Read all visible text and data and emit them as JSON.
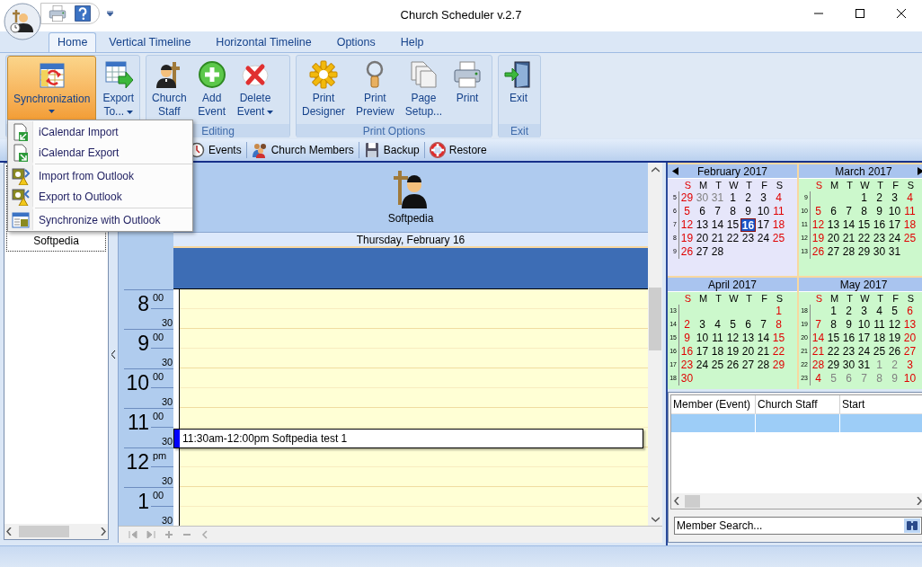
{
  "window": {
    "title": "Church Scheduler v.2.7"
  },
  "tabs": [
    {
      "label": "Home",
      "selected": true
    },
    {
      "label": "Vertical Timeline",
      "selected": false
    },
    {
      "label": "Horizontal Timeline",
      "selected": false
    },
    {
      "label": "Options",
      "selected": false
    },
    {
      "label": "Help",
      "selected": false
    }
  ],
  "ribbon": {
    "groups": [
      {
        "buttons": [
          {
            "lines": [
              "Synchronization"
            ],
            "dropdown": true,
            "selected": true
          },
          {
            "lines": [
              "Export",
              "To..."
            ],
            "dropdown": true,
            "selected": false
          }
        ]
      },
      {
        "label": "Editing",
        "buttons": [
          {
            "lines": [
              "Church",
              "Staff"
            ],
            "dropdown": false,
            "selected": false
          },
          {
            "lines": [
              "Add",
              "Event"
            ],
            "dropdown": false,
            "selected": false
          },
          {
            "lines": [
              "Delete",
              "Event"
            ],
            "dropdown": true,
            "selected": false
          }
        ]
      },
      {
        "label": "Print Options",
        "buttons": [
          {
            "lines": [
              "Print",
              "Designer"
            ],
            "dropdown": false,
            "selected": false
          },
          {
            "lines": [
              "Print",
              "Preview"
            ],
            "dropdown": false,
            "selected": false
          },
          {
            "lines": [
              "Page",
              "Setup..."
            ],
            "dropdown": false,
            "selected": false
          },
          {
            "lines": [
              "Print"
            ],
            "dropdown": false,
            "selected": false
          }
        ]
      },
      {
        "label": "Exit",
        "buttons": [
          {
            "lines": [
              "Exit"
            ],
            "dropdown": false,
            "selected": false
          }
        ]
      }
    ]
  },
  "menu": {
    "items": [
      {
        "label": "iCalendar Import",
        "separator_before": false
      },
      {
        "label": "iCalendar Export",
        "separator_before": false
      },
      {
        "label": "Import from Outlook",
        "separator_before": true
      },
      {
        "label": "Export to Outlook",
        "separator_before": false
      },
      {
        "label": "Synchronize with Outlook",
        "separator_before": true
      }
    ]
  },
  "toolbar": {
    "items": [
      {
        "label": "Events"
      },
      {
        "label": "Church Members"
      },
      {
        "label": "Backup"
      },
      {
        "label": "Restore"
      }
    ]
  },
  "left_panel": {
    "items": [
      {
        "label": "Softpedia"
      }
    ]
  },
  "day_view": {
    "resource": "Softpedia",
    "date": "Thursday, February 16",
    "hours": [
      {
        "hour": "8",
        "first": "00",
        "second": "30"
      },
      {
        "hour": "9",
        "first": "00",
        "second": "30"
      },
      {
        "hour": "10",
        "first": "00",
        "second": "30"
      },
      {
        "hour": "11",
        "first": "00",
        "second": "30"
      },
      {
        "hour": "12",
        "first": "pm",
        "second": "30"
      },
      {
        "hour": "1",
        "first": "00",
        "second": "30"
      }
    ],
    "appointments": [
      {
        "text": "11:30am-12:00pm Softpedia test 1"
      }
    ]
  },
  "calendars": [
    {
      "title": "February 2017",
      "color": "#e6e6fa",
      "weekdays": [
        "S",
        "M",
        "T",
        "W",
        "T",
        "F",
        "S"
      ],
      "weeks": [
        {
          "week": "5",
          "days": [
            {
              "text": "29",
              "selected": false
            },
            {
              "text": "30",
              "selected": false,
              "muted": true
            },
            {
              "text": "31",
              "selected": false,
              "muted": true
            },
            {
              "text": "1",
              "selected": false
            },
            {
              "text": "2",
              "selected": false
            },
            {
              "text": "3",
              "selected": false
            },
            {
              "text": "4",
              "selected": false
            }
          ]
        },
        {
          "week": "6",
          "days": [
            {
              "text": "5",
              "selected": false
            },
            {
              "text": "6",
              "selected": false
            },
            {
              "text": "7",
              "selected": false
            },
            {
              "text": "8",
              "selected": false
            },
            {
              "text": "9",
              "selected": false
            },
            {
              "text": "10",
              "selected": false
            },
            {
              "text": "11",
              "selected": false
            }
          ]
        },
        {
          "week": "7",
          "days": [
            {
              "text": "12",
              "selected": false
            },
            {
              "text": "13",
              "selected": false
            },
            {
              "text": "14",
              "selected": false
            },
            {
              "text": "15",
              "selected": false
            },
            {
              "text": "16",
              "selected": true
            },
            {
              "text": "17",
              "selected": false
            },
            {
              "text": "18",
              "selected": false
            }
          ]
        },
        {
          "week": "8",
          "days": [
            {
              "text": "19",
              "selected": false
            },
            {
              "text": "20",
              "selected": false
            },
            {
              "text": "21",
              "selected": false
            },
            {
              "text": "22",
              "selected": false
            },
            {
              "text": "23",
              "selected": false
            },
            {
              "text": "24",
              "selected": false
            },
            {
              "text": "25",
              "selected": false
            }
          ]
        },
        {
          "week": "9",
          "days": [
            {
              "text": "26",
              "selected": false
            },
            {
              "text": "27",
              "selected": false
            },
            {
              "text": "28",
              "selected": false
            }
          ]
        }
      ]
    },
    {
      "title": "March 2017",
      "color": "#ccf8cc",
      "weekdays": [
        "S",
        "M",
        "T",
        "W",
        "T",
        "F",
        "S"
      ],
      "weeks": [
        {
          "week": "9",
          "days": [
            {
              "text": "1",
              "selected": false
            },
            {
              "text": "2",
              "selected": false
            },
            {
              "text": "3",
              "selected": false
            },
            {
              "text": "4",
              "selected": false
            }
          ]
        },
        {
          "week": "10",
          "days": [
            {
              "text": "5",
              "selected": false
            },
            {
              "text": "6",
              "selected": false
            },
            {
              "text": "7",
              "selected": false
            },
            {
              "text": "8",
              "selected": false
            },
            {
              "text": "9",
              "selected": false
            },
            {
              "text": "10",
              "selected": false
            },
            {
              "text": "11",
              "selected": false
            }
          ]
        },
        {
          "week": "11",
          "days": [
            {
              "text": "12",
              "selected": false
            },
            {
              "text": "13",
              "selected": false
            },
            {
              "text": "14",
              "selected": false
            },
            {
              "text": "15",
              "selected": false
            },
            {
              "text": "16",
              "selected": false
            },
            {
              "text": "17",
              "selected": false
            },
            {
              "text": "18",
              "selected": false
            }
          ]
        },
        {
          "week": "12",
          "days": [
            {
              "text": "19",
              "selected": false
            },
            {
              "text": "20",
              "selected": false
            },
            {
              "text": "21",
              "selected": false
            },
            {
              "text": "22",
              "selected": false
            },
            {
              "text": "23",
              "selected": false
            },
            {
              "text": "24",
              "selected": false
            },
            {
              "text": "25",
              "selected": false
            }
          ]
        },
        {
          "week": "13",
          "days": [
            {
              "text": "26",
              "selected": false
            },
            {
              "text": "27",
              "selected": false
            },
            {
              "text": "28",
              "selected": false
            },
            {
              "text": "29",
              "selected": false
            },
            {
              "text": "30",
              "selected": false
            },
            {
              "text": "31",
              "selected": false
            }
          ]
        }
      ]
    },
    {
      "title": "April 2017",
      "color": "#ccf8cc",
      "weekdays": [
        "S",
        "M",
        "T",
        "W",
        "T",
        "F",
        "S"
      ],
      "weeks": [
        {
          "week": "13",
          "days": [
            {
              "text": "1",
              "selected": false
            }
          ]
        },
        {
          "week": "14",
          "days": [
            {
              "text": "2",
              "selected": false
            },
            {
              "text": "3",
              "selected": false
            },
            {
              "text": "4",
              "selected": false
            },
            {
              "text": "5",
              "selected": false
            },
            {
              "text": "6",
              "selected": false
            },
            {
              "text": "7",
              "selected": false
            },
            {
              "text": "8",
              "selected": false
            }
          ]
        },
        {
          "week": "15",
          "days": [
            {
              "text": "9",
              "selected": false
            },
            {
              "text": "10",
              "selected": false
            },
            {
              "text": "11",
              "selected": false
            },
            {
              "text": "12",
              "selected": false
            },
            {
              "text": "13",
              "selected": false
            },
            {
              "text": "14",
              "selected": false
            },
            {
              "text": "15",
              "selected": false
            }
          ]
        },
        {
          "week": "16",
          "days": [
            {
              "text": "16",
              "selected": false
            },
            {
              "text": "17",
              "selected": false
            },
            {
              "text": "18",
              "selected": false
            },
            {
              "text": "19",
              "selected": false
            },
            {
              "text": "20",
              "selected": false
            },
            {
              "text": "21",
              "selected": false
            },
            {
              "text": "22",
              "selected": false
            }
          ]
        },
        {
          "week": "17",
          "days": [
            {
              "text": "23",
              "selected": false
            },
            {
              "text": "24",
              "selected": false
            },
            {
              "text": "25",
              "selected": false
            },
            {
              "text": "26",
              "selected": false
            },
            {
              "text": "27",
              "selected": false
            },
            {
              "text": "28",
              "selected": false
            },
            {
              "text": "29",
              "selected": false
            }
          ]
        },
        {
          "week": "18",
          "days": [
            {
              "text": "30",
              "selected": false
            }
          ]
        }
      ]
    },
    {
      "title": "May 2017",
      "color": "#ccf8cc",
      "weekdays": [
        "S",
        "M",
        "T",
        "W",
        "T",
        "F",
        "S"
      ],
      "weeks": [
        {
          "week": "18",
          "days": [
            {
              "text": "1",
              "selected": false
            },
            {
              "text": "2",
              "selected": false
            },
            {
              "text": "3",
              "selected": false
            },
            {
              "text": "4",
              "selected": false
            },
            {
              "text": "5",
              "selected": false
            },
            {
              "text": "6",
              "selected": false
            }
          ]
        },
        {
          "week": "19",
          "days": [
            {
              "text": "7",
              "selected": false
            },
            {
              "text": "8",
              "selected": false
            },
            {
              "text": "9",
              "selected": false
            },
            {
              "text": "10",
              "selected": false
            },
            {
              "text": "11",
              "selected": false
            },
            {
              "text": "12",
              "selected": false
            },
            {
              "text": "13",
              "selected": false
            }
          ]
        },
        {
          "week": "20",
          "days": [
            {
              "text": "14",
              "selected": false
            },
            {
              "text": "15",
              "selected": false
            },
            {
              "text": "16",
              "selected": false
            },
            {
              "text": "17",
              "selected": false
            },
            {
              "text": "18",
              "selected": false
            },
            {
              "text": "19",
              "selected": false
            },
            {
              "text": "20",
              "selected": false
            }
          ]
        },
        {
          "week": "21",
          "days": [
            {
              "text": "21",
              "selected": false
            },
            {
              "text": "22",
              "selected": false
            },
            {
              "text": "23",
              "selected": false
            },
            {
              "text": "24",
              "selected": false
            },
            {
              "text": "25",
              "selected": false
            },
            {
              "text": "26",
              "selected": false
            },
            {
              "text": "27",
              "selected": false
            }
          ]
        },
        {
          "week": "22",
          "days": [
            {
              "text": "28",
              "selected": false
            },
            {
              "text": "29",
              "selected": false
            },
            {
              "text": "30",
              "selected": false
            },
            {
              "text": "31",
              "selected": false
            },
            {
              "text": "1",
              "selected": false,
              "muted": true
            },
            {
              "text": "2",
              "selected": false,
              "muted": true
            },
            {
              "text": "3",
              "selected": false
            }
          ]
        },
        {
          "week": "23",
          "days": [
            {
              "text": "4",
              "selected": false
            },
            {
              "text": "5",
              "selected": false,
              "muted": true
            },
            {
              "text": "6",
              "selected": false,
              "muted": true
            },
            {
              "text": "7",
              "selected": false,
              "muted": true
            },
            {
              "text": "8",
              "selected": false,
              "muted": true
            },
            {
              "text": "9",
              "selected": false,
              "muted": true
            },
            {
              "text": "10",
              "selected": false
            }
          ]
        }
      ]
    }
  ],
  "table": {
    "columns": [
      "Member (Event)",
      "Church Staff",
      "Start"
    ],
    "rows": [
      {
        "selected": true
      }
    ]
  },
  "search": {
    "placeholder": "Member Search..."
  }
}
